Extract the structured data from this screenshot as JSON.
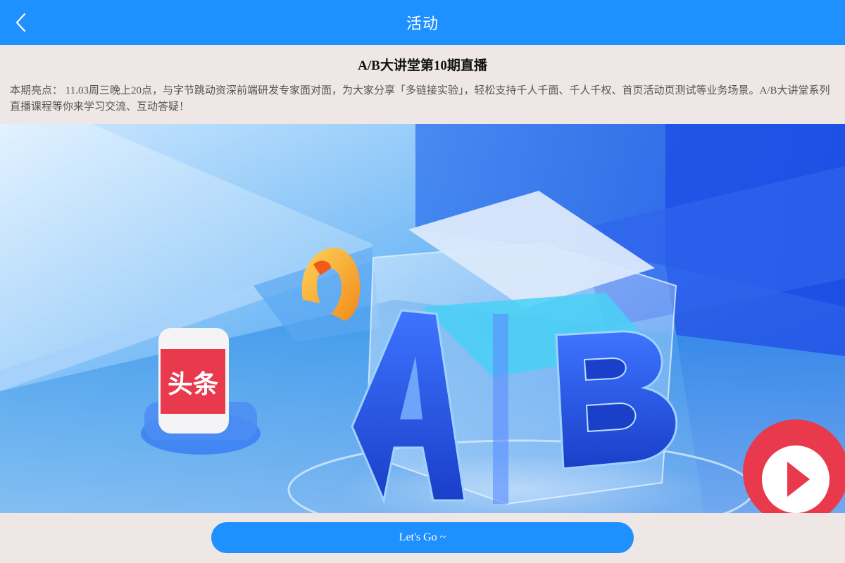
{
  "nav": {
    "title": "活动",
    "back_icon": "chevron-left-icon"
  },
  "activity": {
    "title": "A/B大讲堂第10期直播",
    "description": "本期亮点： 11.03周三晚上20点，与字节跳动资深前端研发专家面对面，为大家分享「多链接实验」，轻松支持千人千面、千人千权、首页活动页测试等业务场景。A/B大讲堂系列直播课程等你来学习交流、互动答疑！"
  },
  "banner": {
    "toutiao_badge": "头条",
    "cube_letters": "A/B",
    "colors": {
      "primary": "#1e90ff",
      "background": "#eee7e6",
      "toutiao_red": "#e8394d"
    }
  },
  "footer": {
    "cta_label": "Let's Go ~"
  }
}
